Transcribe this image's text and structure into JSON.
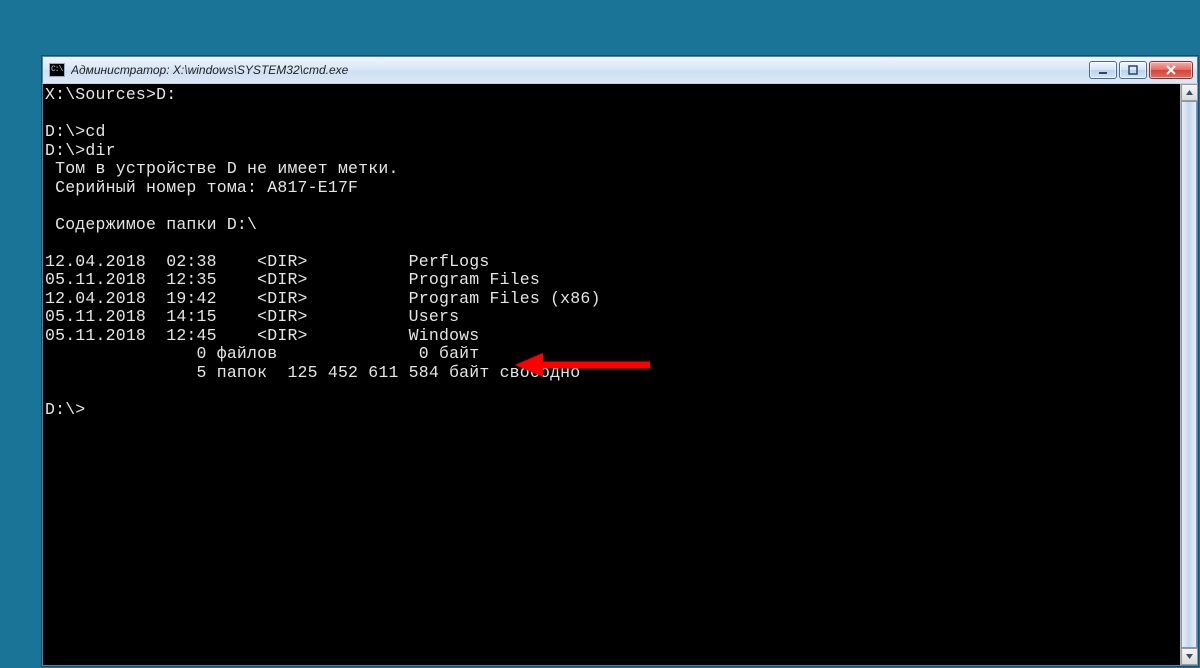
{
  "title": "Администратор: X:\\windows\\SYSTEM32\\cmd.exe",
  "icon_label": "C:\\",
  "lines": {
    "l0": "X:\\Sources>D:",
    "l1": "",
    "l2": "D:\\>cd",
    "l3": "D:\\>dir",
    "l4": " Том в устройстве D не имеет метки.",
    "l5": " Серийный номер тома: A817-E17F",
    "l6": "",
    "l7": " Содержимое папки D:\\",
    "l8": "",
    "l9": "12.04.2018  02:38    <DIR>          PerfLogs",
    "l10": "05.11.2018  12:35    <DIR>          Program Files",
    "l11": "12.04.2018  19:42    <DIR>          Program Files (x86)",
    "l12": "05.11.2018  14:15    <DIR>          Users",
    "l13": "05.11.2018  12:45    <DIR>          Windows",
    "l14": "               0 файлов              0 байт",
    "l15": "               5 папок  125 452 611 584 байт свободно",
    "l16": "",
    "l17": "D:\\>"
  },
  "annotation": {
    "arrow_color": "#ff0000"
  }
}
